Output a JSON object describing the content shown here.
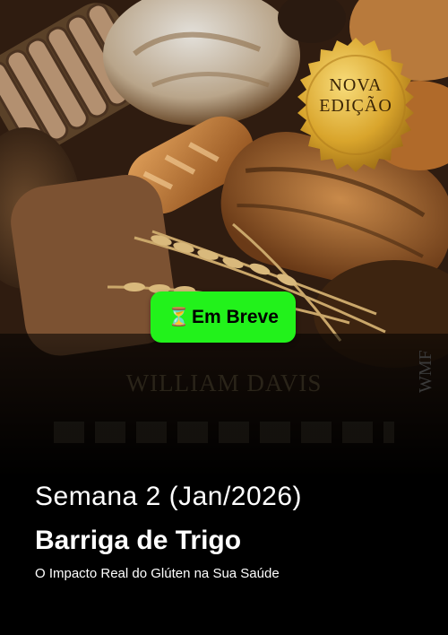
{
  "cover": {
    "seal_line1": "NOVA",
    "seal_line2": "EDIÇÃO",
    "author": "WILLIAM DAVIS",
    "publisher_mark": "WMF"
  },
  "badge": {
    "icon": "hourglass-icon",
    "icon_glyph": "⏳",
    "label": "Em Breve",
    "color": "#22f21b"
  },
  "info": {
    "week": "Semana 2 (Jan/2026)",
    "title": "Barriga de Trigo",
    "subtitle": "O Impacto Real do Glúten na Sua Saúde"
  }
}
